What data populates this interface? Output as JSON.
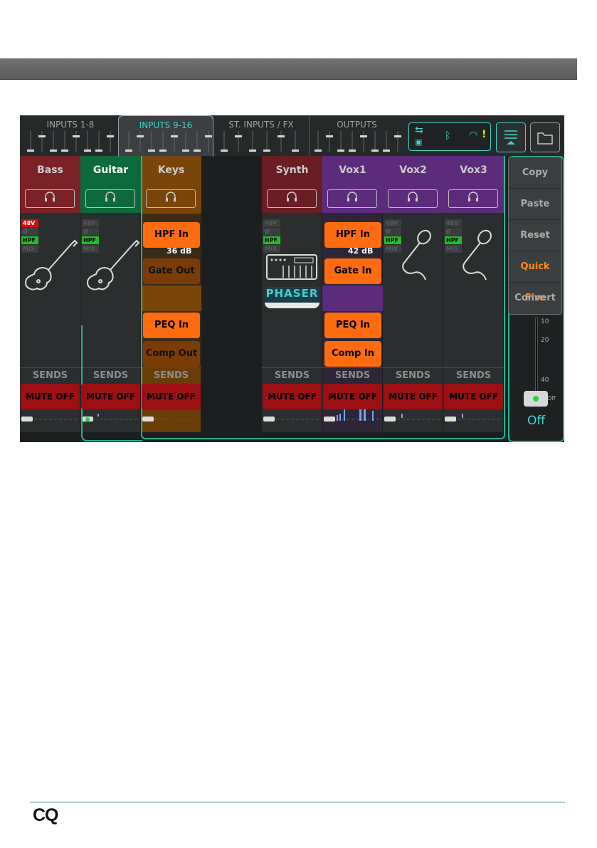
{
  "footer": {
    "logo": "CQ"
  },
  "tabs": [
    {
      "label": "INPUTS 1-8",
      "active": false
    },
    {
      "label": "INPUTS 9-16",
      "active": true
    },
    {
      "label": "ST. INPUTS / FX",
      "active": false
    },
    {
      "label": "OUTPUTS",
      "active": false
    }
  ],
  "status": {
    "icons": [
      "usb-icon",
      "sd-card-icon",
      "bluetooth-icon",
      "wifi-warning-icon"
    ]
  },
  "channels": [
    {
      "name": "Bass",
      "color": "#7a2125",
      "sends": "SENDS",
      "mute": "MUTE OFF",
      "icon": "bass-guitar-icon",
      "tags": [
        "48V",
        "Ø",
        "HPF",
        "MIX"
      ]
    },
    {
      "name": "Guitar",
      "color": "#0c6a3c",
      "sends": "SENDS",
      "mute": "MUTE OFF",
      "icon": "guitar-icon",
      "tags": [
        "48V",
        "Ø",
        "HPF",
        "MIX"
      ]
    },
    {
      "name": "Keys",
      "color": "#7a4508",
      "sends": "SENDS",
      "mute": "MUTE OFF",
      "icon": "",
      "tags": []
    },
    {
      "name": "Synth",
      "color": "#6a1d22",
      "sends": "SENDS",
      "mute": "MUTE OFF",
      "icon": "keyboard-icon",
      "tags": [
        "48V",
        "Ø",
        "HPF",
        "MIX"
      ]
    },
    {
      "name": "Vox1",
      "color": "#5c2c7c",
      "sends": "SENDS",
      "mute": "MUTE OFF",
      "icon": "",
      "tags": []
    },
    {
      "name": "Vox2",
      "color": "#5c2c7c",
      "sends": "SENDS",
      "mute": "MUTE OFF",
      "icon": "microphone-icon",
      "tags": [
        "48V",
        "Ø",
        "HPF",
        "MIX"
      ]
    },
    {
      "name": "Vox3",
      "color": "#5c2c7c",
      "sends": "SENDS",
      "mute": "MUTE OFF",
      "icon": "microphone-icon",
      "tags": [
        "48V",
        "Ø",
        "HPF",
        "MIX"
      ]
    }
  ],
  "keys_popups": {
    "hpf": "HPF In",
    "gain": "36 dB",
    "gate": "Gate Out",
    "peq": "PEQ In",
    "comp": "Comp Out"
  },
  "vox1_popups": {
    "hpf": "HPF In",
    "gain": "42 dB",
    "gate": "Gate In",
    "peq": "PEQ In",
    "comp": "Comp In"
  },
  "synth_fx": "PHASER",
  "menu": [
    "Copy",
    "Paste",
    "Reset",
    "Quick Fire",
    "Convert"
  ],
  "master": {
    "scale": [
      "10",
      "20",
      "40",
      "Off"
    ],
    "value": "Off"
  }
}
